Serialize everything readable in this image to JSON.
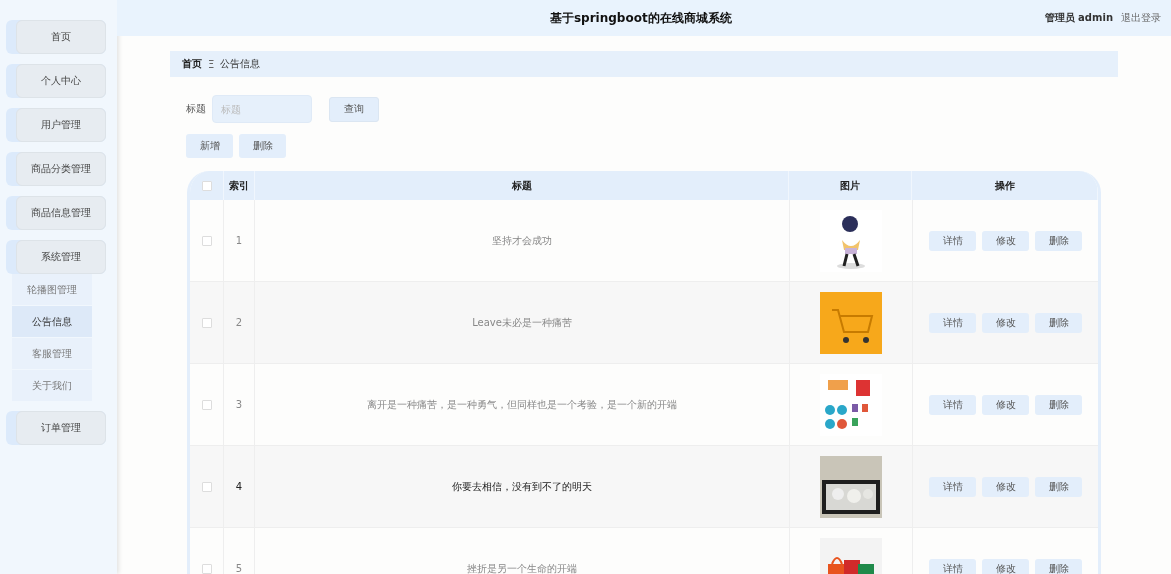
{
  "header": {
    "title": "基于springboot的在线商城系统",
    "user": "管理员 admin",
    "logout": "退出登录"
  },
  "sidebar": {
    "items": [
      {
        "label": "首页"
      },
      {
        "label": "个人中心"
      },
      {
        "label": "用户管理"
      },
      {
        "label": "商品分类管理"
      },
      {
        "label": "商品信息管理"
      },
      {
        "label": "系统管理",
        "children": [
          {
            "label": "轮播图管理",
            "selected": false
          },
          {
            "label": "公告信息",
            "selected": true
          },
          {
            "label": "客服管理",
            "selected": false
          },
          {
            "label": "关于我们",
            "selected": false
          }
        ]
      },
      {
        "label": "订单管理"
      }
    ]
  },
  "breadcrumb": {
    "home": "首页",
    "separator": "Ξ",
    "current": "公告信息"
  },
  "search": {
    "label": "标题",
    "placeholder": "标题",
    "button": "查询"
  },
  "actions": [
    "新增",
    "删除"
  ],
  "table": {
    "header_checked": false,
    "columns": [
      "索引",
      "标题",
      "图片",
      "操作"
    ],
    "rows": [
      {
        "index": "1",
        "title": "坚持才会成功",
        "checked": false,
        "hovered": false,
        "buttons": [
          "详情",
          "修改",
          "删除"
        ]
      },
      {
        "index": "2",
        "title": "Leave未必是一种痛苦",
        "checked": false,
        "hovered": false,
        "buttons": [
          "详情",
          "修改",
          "删除"
        ]
      },
      {
        "index": "3",
        "title": "离开是一种痛苦，是一种勇气，但同样也是一个考验，是一个新的开端",
        "checked": false,
        "hovered": false,
        "buttons": [
          "详情",
          "修改",
          "删除"
        ]
      },
      {
        "index": "4",
        "title": "你要去相信，没有到不了的明天",
        "checked": false,
        "hovered": true,
        "buttons": [
          "详情",
          "修改",
          "删除"
        ]
      },
      {
        "index": "5",
        "title": "挫折是另一个生命的开端",
        "checked": false,
        "hovered": false,
        "buttons": [
          "详情",
          "修改",
          "删除"
        ]
      }
    ]
  }
}
